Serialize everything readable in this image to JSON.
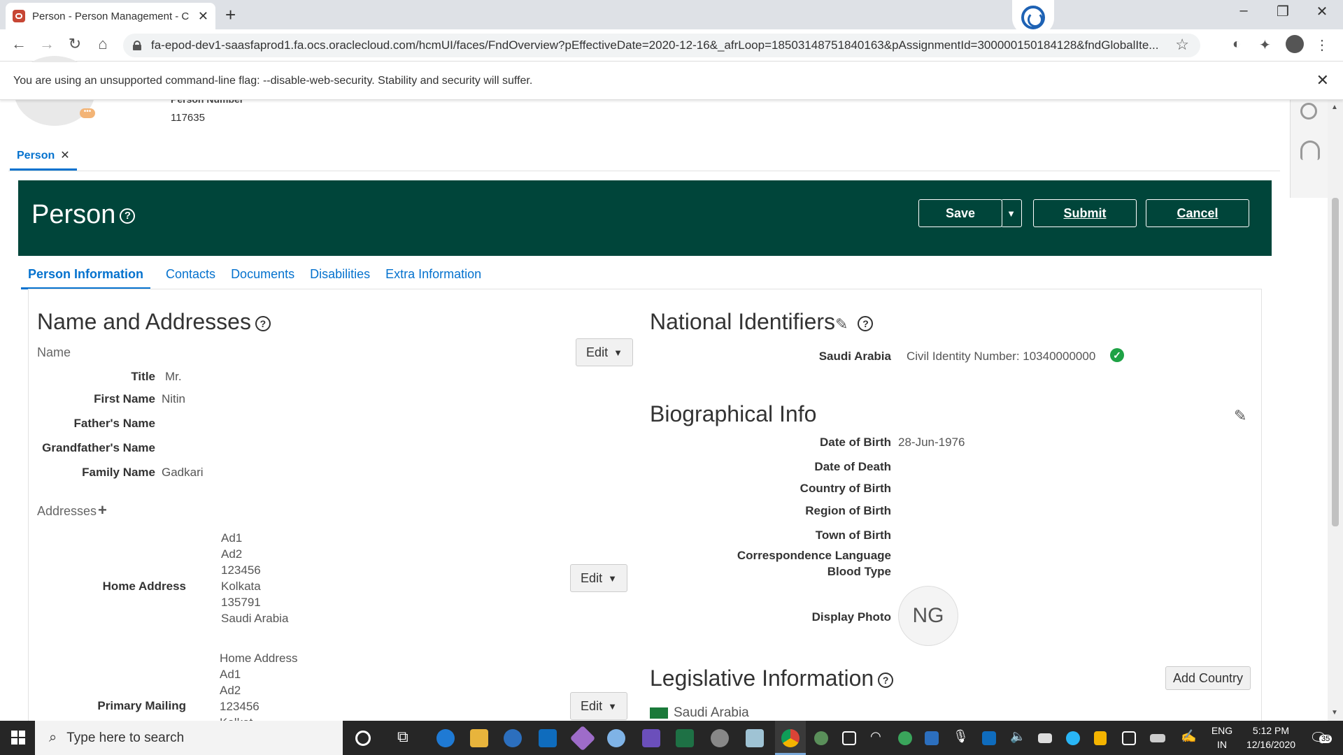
{
  "browser": {
    "tab_title": "Person - Person Management - C",
    "tab_close": "✕",
    "new_tab": "+",
    "url": "fa-epod-dev1-saasfaprod1.fa.ocs.oraclecloud.com/hcmUI/faces/FndOverview?pEffectiveDate=2020-12-16&_afrLoop=18503148751840163&pAssignmentId=300000150184128&fndGlobalIte...",
    "infobar_text": "You are using an unsupported command-line flag: --disable-web-security. Stability and security will suffer.",
    "window_controls": [
      "–",
      "❐",
      "✕"
    ]
  },
  "page": {
    "person_number_label": "Person Number",
    "person_number": "117635",
    "tab_label": "Person",
    "header_title": "Person",
    "buttons": {
      "save": "Save",
      "submit": "Submit",
      "cancel": "Cancel"
    },
    "subtabs": [
      "Person Information",
      "Contacts",
      "Documents",
      "Disabilities",
      "Extra Information"
    ]
  },
  "name_addresses": {
    "title": "Name and Addresses",
    "name_subhead": "Name",
    "edit_label": "Edit",
    "fields": [
      {
        "label": "Title",
        "value": "Mr."
      },
      {
        "label": "First Name",
        "value": "Nitin"
      },
      {
        "label": "Father's Name",
        "value": ""
      },
      {
        "label": "Grandfather's Name",
        "value": ""
      },
      {
        "label": "Family Name",
        "value": "Gadkari"
      }
    ],
    "addresses_subhead": "Addresses",
    "home_address_label": "Home Address",
    "home_address_lines": [
      "Ad1",
      "Ad2",
      "123456",
      "Kolkata",
      "135791",
      "Saudi Arabia"
    ],
    "primary_mailing_label": "Primary Mailing",
    "primary_mailing_lines": [
      "Home Address",
      "Ad1",
      "Ad2",
      "123456",
      "Kolkat"
    ]
  },
  "national_identifiers": {
    "title": "National Identifiers",
    "country": "Saudi Arabia",
    "identifier": "Civil Identity Number: 10340000000"
  },
  "biographical": {
    "title": "Biographical Info",
    "fields": [
      {
        "label": "Date of Birth",
        "value": "28-Jun-1976"
      },
      {
        "label": "Date of Death",
        "value": ""
      },
      {
        "label": "Country of Birth",
        "value": ""
      },
      {
        "label": "Region of Birth",
        "value": ""
      },
      {
        "label": "Town of Birth",
        "value": ""
      },
      {
        "label": "Correspondence Language",
        "value": ""
      },
      {
        "label": "Blood Type",
        "value": ""
      }
    ],
    "display_photo_label": "Display Photo",
    "photo_initials": "NG"
  },
  "legislative": {
    "title": "Legislative Information",
    "add_country": "Add Country",
    "country": "Saudi Arabia"
  },
  "taskbar": {
    "search_placeholder": "Type here to search",
    "lang_top": "ENG",
    "lang_bottom": "IN",
    "time": "5:12 PM",
    "date": "12/16/2020",
    "notifications": "35"
  },
  "colors": {
    "header_bg": "#00453a",
    "link": "#0572ce",
    "check": "#1ea245"
  }
}
